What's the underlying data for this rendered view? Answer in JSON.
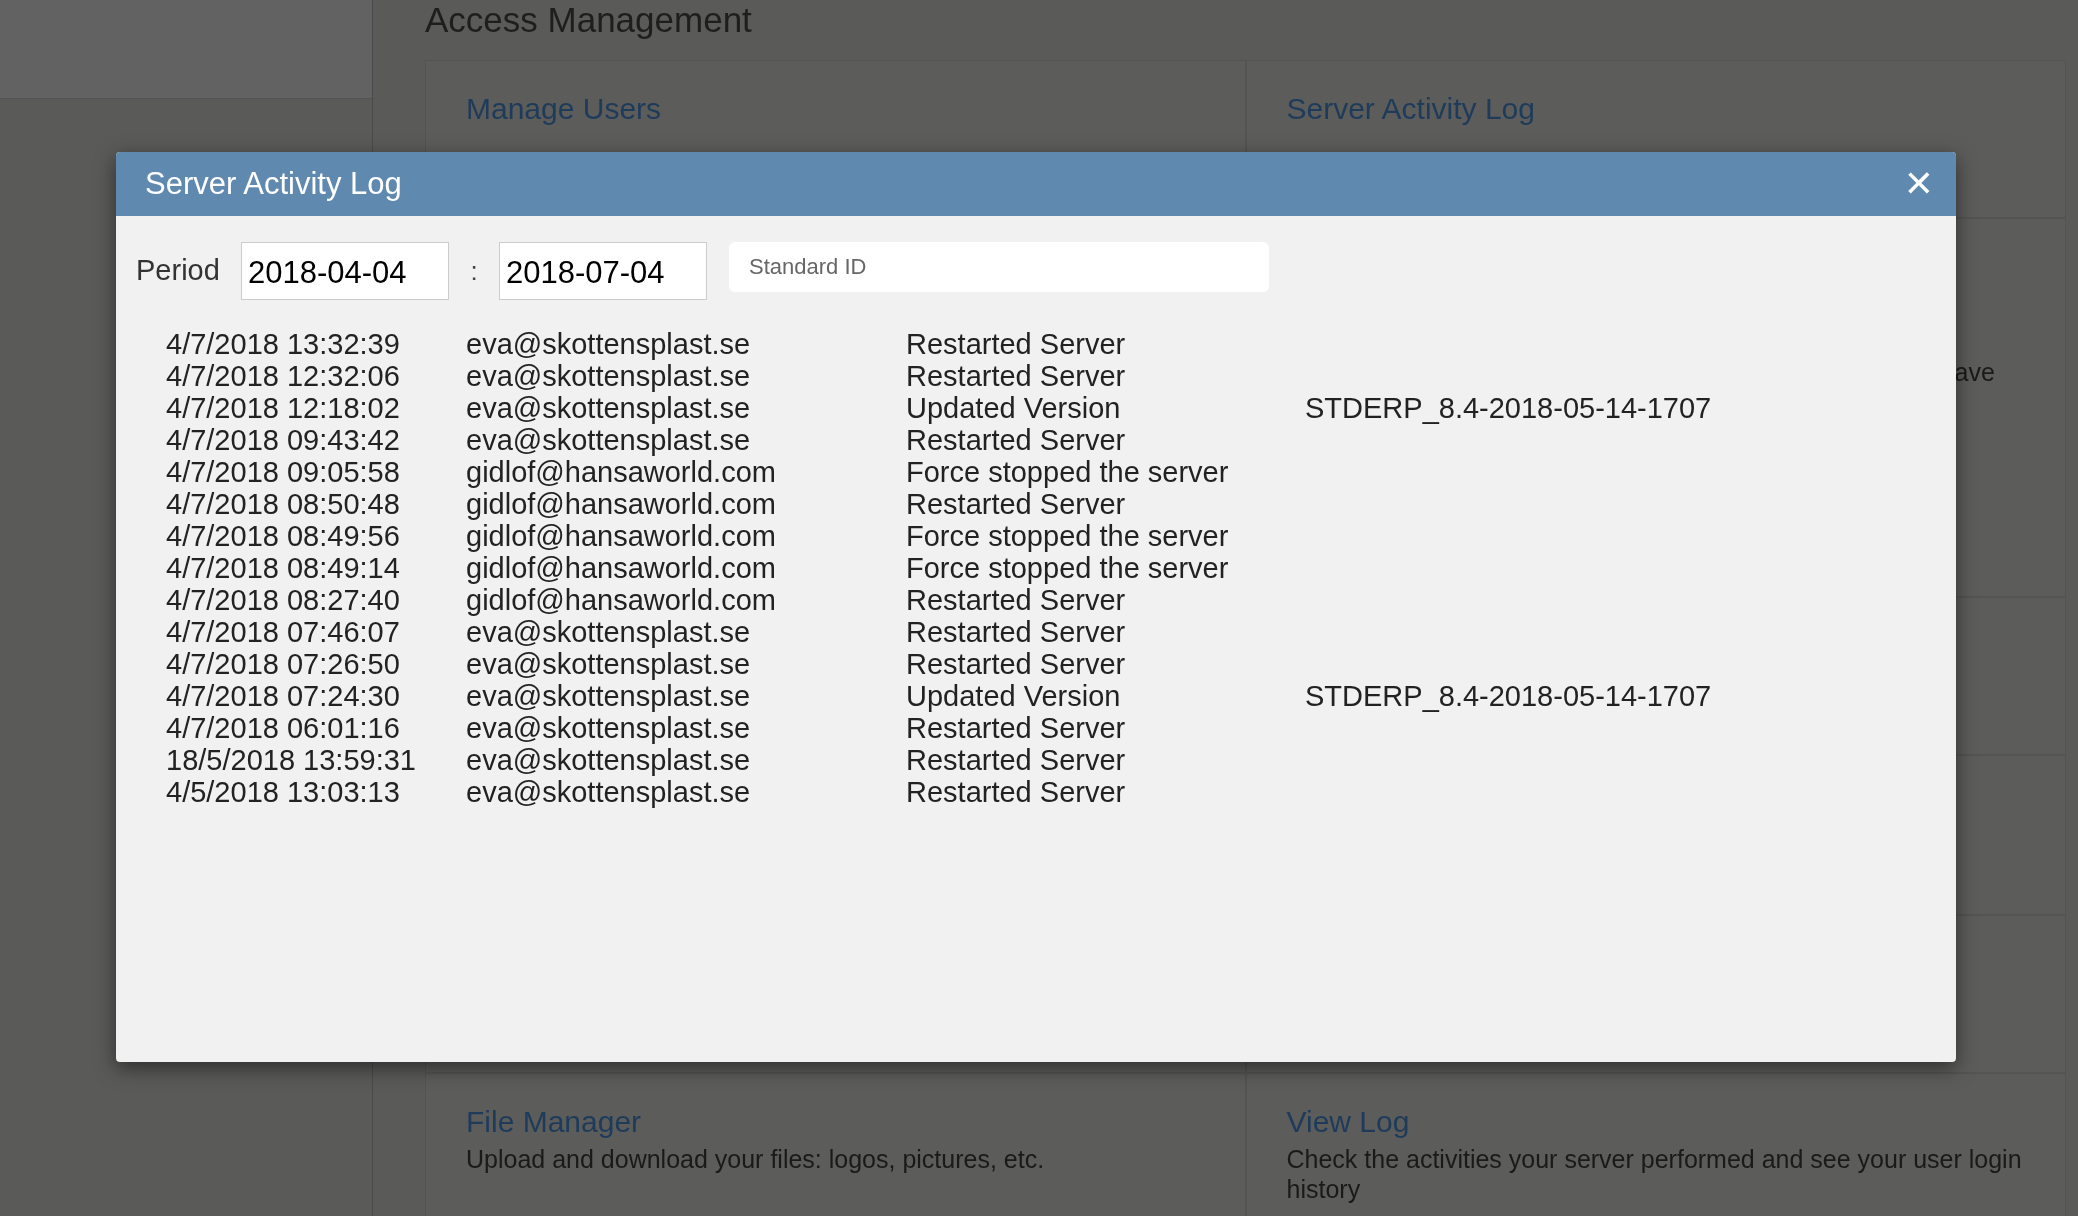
{
  "page": {
    "title": "Access Management",
    "cards": [
      {
        "title": "Manage Users"
      },
      {
        "title": "Server Activity Log"
      },
      {
        "description": "ave"
      },
      {
        "title": "File Manager",
        "description": "Upload and download your files: logos, pictures, etc."
      },
      {
        "title": "View Log",
        "description": "Check the activities your server performed and see your user login history"
      }
    ]
  },
  "dialog": {
    "title": "Server Activity Log",
    "close": "✕",
    "period_label": "Period",
    "from": "2018-04-04",
    "separator": ":",
    "to": "2018-07-04",
    "search": {
      "placeholder": "Standard ID"
    },
    "rows": [
      {
        "time": "4/7/2018 13:32:39",
        "user": "eva@skottensplast.se",
        "action": "Restarted Server"
      },
      {
        "time": "4/7/2018 12:32:06",
        "user": "eva@skottensplast.se",
        "action": "Restarted Server"
      },
      {
        "time": "4/7/2018 12:18:02",
        "user": "eva@skottensplast.se",
        "action": "Updated Version",
        "version": "STDERP_8.4-2018-05-14-1707"
      },
      {
        "time": "4/7/2018 09:43:42",
        "user": "eva@skottensplast.se",
        "action": "Restarted Server"
      },
      {
        "time": "4/7/2018 09:05:58",
        "user": "gidlof@hansaworld.com",
        "action": "Force stopped the server"
      },
      {
        "time": "4/7/2018 08:50:48",
        "user": "gidlof@hansaworld.com",
        "action": "Restarted Server"
      },
      {
        "time": "4/7/2018 08:49:56",
        "user": "gidlof@hansaworld.com",
        "action": "Force stopped the server"
      },
      {
        "time": "4/7/2018 08:49:14",
        "user": "gidlof@hansaworld.com",
        "action": "Force stopped the server"
      },
      {
        "time": "4/7/2018 08:27:40",
        "user": "gidlof@hansaworld.com",
        "action": "Restarted Server"
      },
      {
        "time": "4/7/2018 07:46:07",
        "user": "eva@skottensplast.se",
        "action": "Restarted Server"
      },
      {
        "time": "4/7/2018 07:26:50",
        "user": "eva@skottensplast.se",
        "action": "Restarted Server"
      },
      {
        "time": "4/7/2018 07:24:30",
        "user": "eva@skottensplast.se",
        "action": "Updated Version",
        "version": "STDERP_8.4-2018-05-14-1707"
      },
      {
        "time": "4/7/2018 06:01:16",
        "user": "eva@skottensplast.se",
        "action": "Restarted Server"
      },
      {
        "time": "18/5/2018 13:59:31",
        "user": "eva@skottensplast.se",
        "action": "Restarted Server"
      },
      {
        "time": "4/5/2018 13:03:13",
        "user": "eva@skottensplast.se",
        "action": "Restarted Server"
      }
    ]
  }
}
